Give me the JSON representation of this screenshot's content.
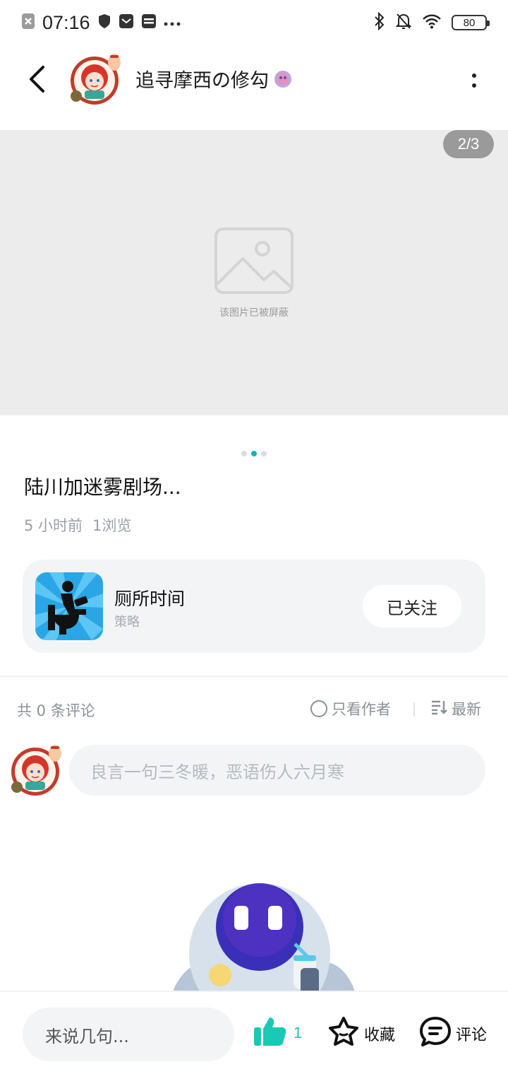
{
  "status_bar": {
    "time": "07:16",
    "battery": "80",
    "left_icons": [
      "app-close-icon",
      "shield-icon",
      "mail-icon",
      "card-icon",
      "more-dots-icon"
    ],
    "right_icons": [
      "bluetooth-icon",
      "bell-off-icon",
      "wifi-icon",
      "battery-icon"
    ]
  },
  "header": {
    "author_name": "追寻摩西の修勾",
    "back_icon": "back-arrow-icon",
    "more_icon": "more-vertical-icon"
  },
  "image": {
    "counter": "2/3",
    "blocked_text": "该图片已被屏蔽",
    "page_count": 3,
    "active_page": 2
  },
  "post": {
    "title": "陆川加迷雾剧场...",
    "time_ago": "5 小时前",
    "views": "1浏览"
  },
  "app_card": {
    "name": "厕所时间",
    "category": "策略",
    "follow_label": "已关注"
  },
  "comments": {
    "count_label": "共 0 条评论",
    "only_author_label": "只看作者",
    "sort_label": "最新",
    "input_placeholder": "良言一句三冬暖，恶语伤人六月寒"
  },
  "bottom_bar": {
    "quick_input": "来说几句...",
    "like_count": "1",
    "favorite_label": "收藏",
    "comment_label": "评论"
  },
  "colors": {
    "accent": "#1ac8b5",
    "dot_active": "#1ab3b3",
    "card_bg": "#f3f4f6",
    "image_placeholder_bg": "#ececec"
  }
}
